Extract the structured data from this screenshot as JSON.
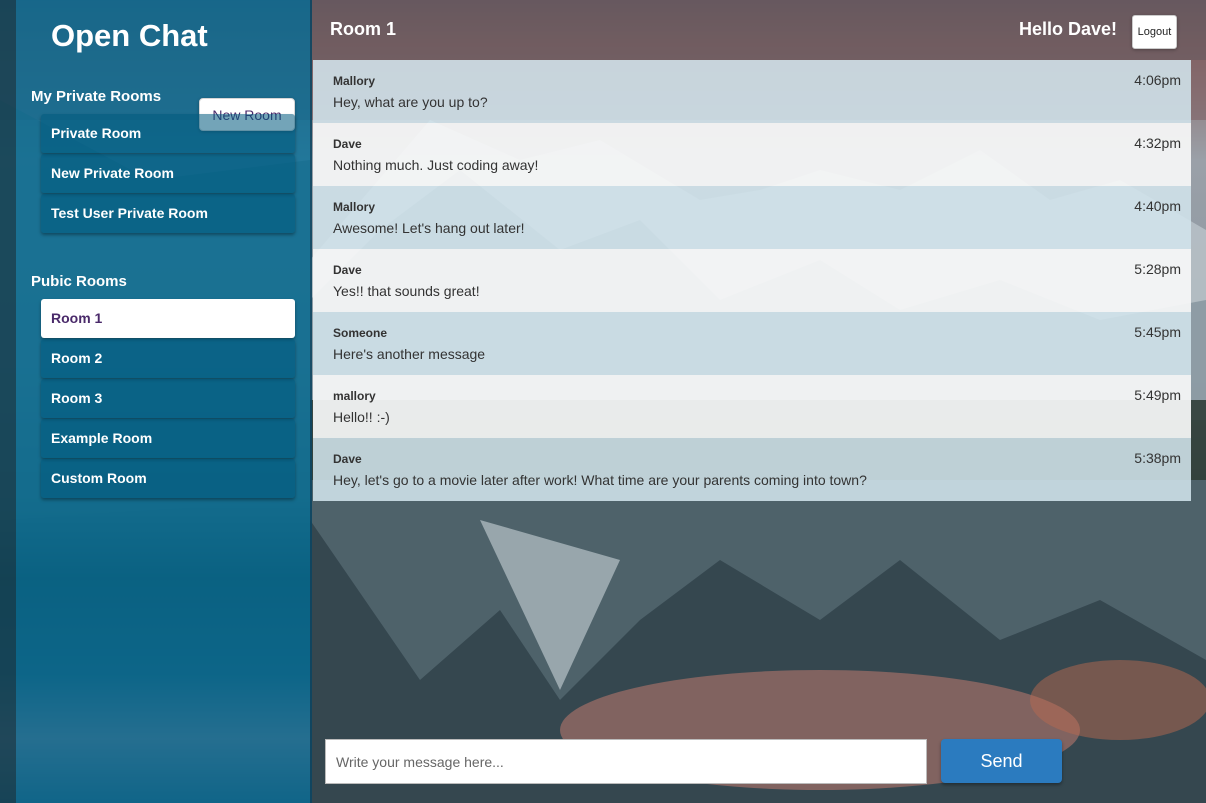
{
  "app": {
    "title": "Open Chat"
  },
  "sidebar": {
    "private_title": "My Private Rooms",
    "new_room_label": "New Room",
    "private_rooms": [
      "Private Room",
      "New Private Room",
      "Test User Private Room"
    ],
    "public_title": "Pubic Rooms",
    "public_rooms": [
      "Room 1",
      "Room 2",
      "Room 3",
      "Example Room",
      "Custom Room"
    ],
    "active_room": "Room 1"
  },
  "header": {
    "room_title": "Room 1",
    "greeting": "Hello Dave!",
    "logout_label": "Logout"
  },
  "messages": [
    {
      "author": "Mallory",
      "text": "Hey, what are you up to?",
      "time": "4:06pm"
    },
    {
      "author": "Dave",
      "text": "Nothing much. Just coding away!",
      "time": "4:32pm"
    },
    {
      "author": "Mallory",
      "text": "Awesome! Let's hang out later!",
      "time": "4:40pm"
    },
    {
      "author": "Dave",
      "text": "Yes!! that sounds great!",
      "time": "5:28pm"
    },
    {
      "author": "Someone",
      "text": "Here's another message",
      "time": "5:45pm"
    },
    {
      "author": "mallory",
      "text": "Hello!! :-)",
      "time": "5:49pm"
    },
    {
      "author": "Dave",
      "text": "Hey, let's go to a movie later after work! What time are your parents coming into town?",
      "time": "5:38pm"
    }
  ],
  "composer": {
    "placeholder": "Write your message here...",
    "send_label": "Send"
  },
  "colors": {
    "sidebar": "#0a6c96",
    "accent": "#2b7bbf",
    "active_text": "#4a2a6a"
  }
}
